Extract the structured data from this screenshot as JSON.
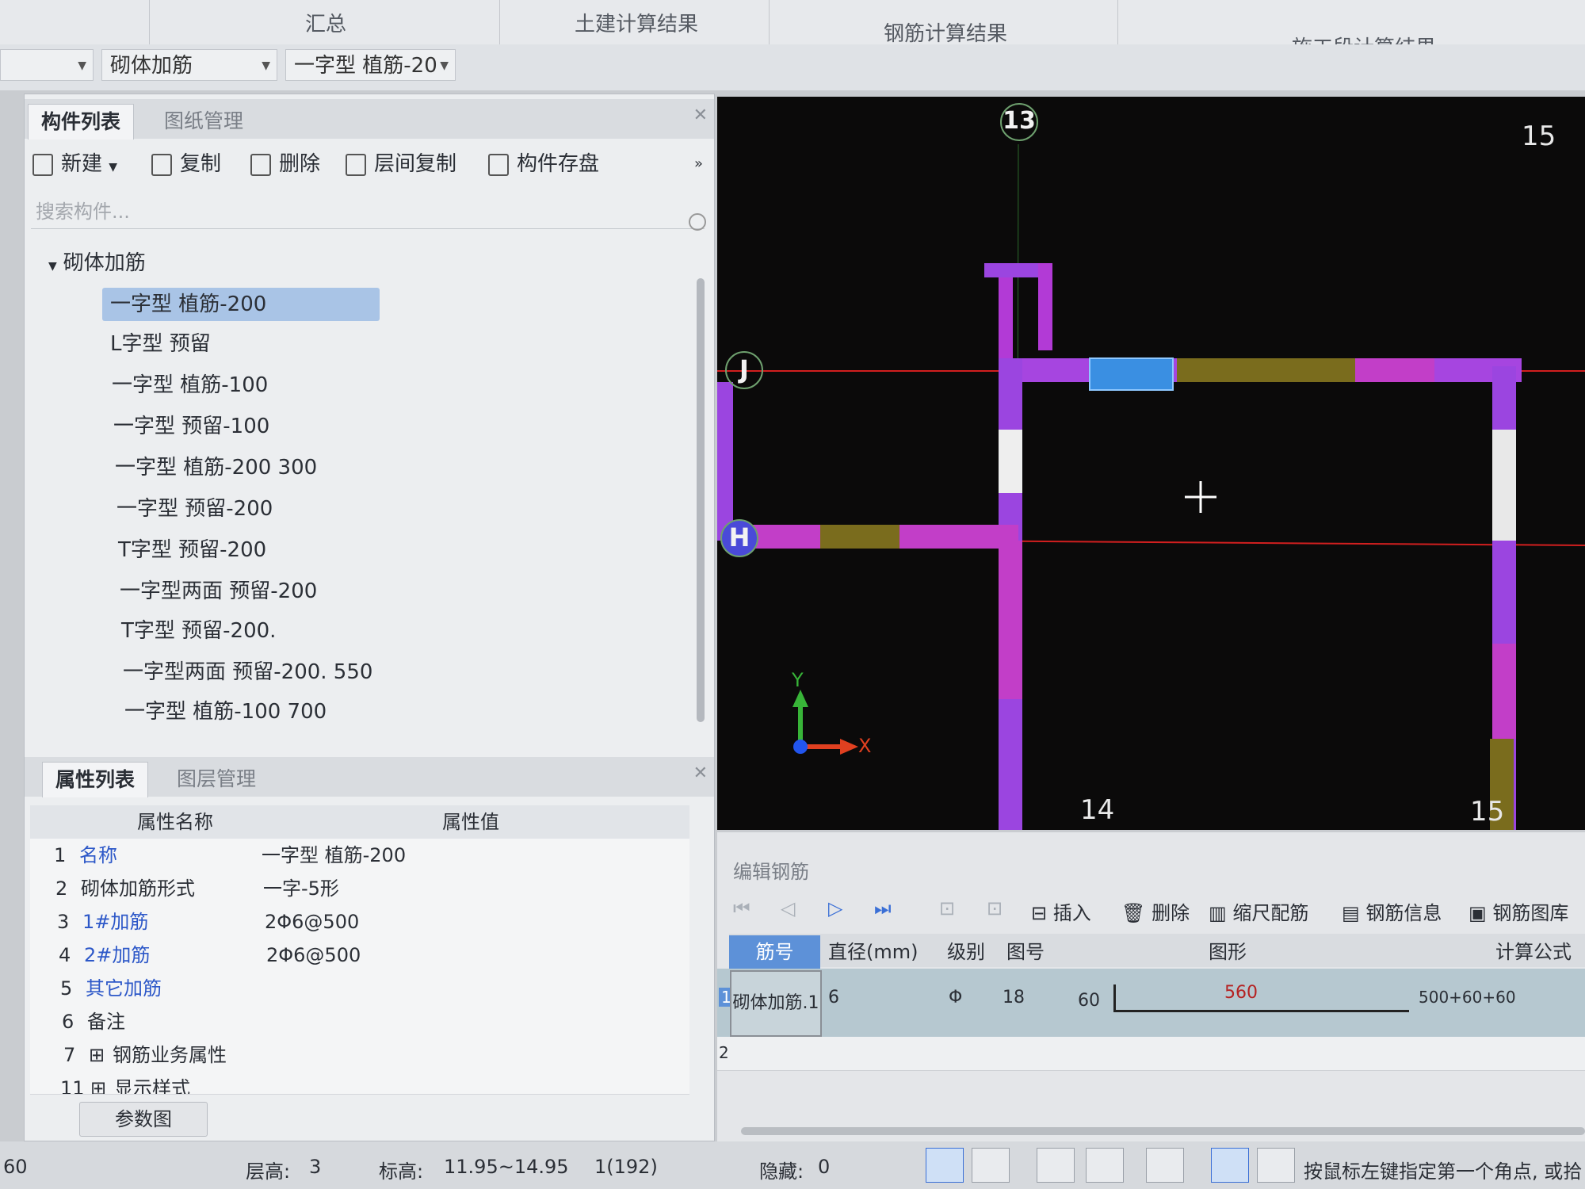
{
  "top_tabs": [
    "汇总",
    "土建计算结果",
    "钢筋计算结果",
    "施工段计算结果"
  ],
  "selectors": {
    "type": "砌体加筋",
    "component": "一字型 植筋-20"
  },
  "component_panel": {
    "tabs": [
      "构件列表",
      "图纸管理"
    ],
    "toolbar": {
      "new": "新建",
      "copy": "复制",
      "delete": "删除",
      "floor_copy": "层间复制",
      "save": "构件存盘"
    },
    "search_placeholder": "搜索构件...",
    "group": "砌体加筋",
    "items": [
      "一字型 植筋-200",
      "L字型 预留",
      "一字型 植筋-100",
      "一字型 预留-100",
      "一字型 植筋-200 300",
      "一字型 预留-200",
      "T字型 预留-200",
      "一字型两面 预留-200",
      "T字型 预留-200.",
      "一字型两面 预留-200. 550",
      "一字型 植筋-100 700"
    ]
  },
  "property_panel": {
    "tabs": [
      "属性列表",
      "图层管理"
    ],
    "headers": {
      "name": "属性名称",
      "value": "属性值"
    },
    "rows": [
      {
        "num": "1",
        "name": "名称",
        "value": "一字型 植筋-200"
      },
      {
        "num": "2",
        "name": "砌体加筋形式",
        "value": "一字-5形"
      },
      {
        "num": "3",
        "name": "1#加筋",
        "value": "2Φ6@500"
      },
      {
        "num": "4",
        "name": "2#加筋",
        "value": "2Φ6@500"
      },
      {
        "num": "5",
        "name": "其它加筋",
        "value": ""
      },
      {
        "num": "6",
        "name": "备注",
        "value": ""
      },
      {
        "num": "7",
        "name": "钢筋业务属性",
        "value": ""
      },
      {
        "num": "11",
        "name": "显示样式",
        "value": ""
      }
    ],
    "param_button": "参数图"
  },
  "canvas": {
    "axis_labels": {
      "top_13": "13",
      "top_15": "15",
      "bottom_14": "14",
      "bottom_15": "15",
      "row_j": "J",
      "row_h": "H"
    },
    "coord_x": "X",
    "coord_y": "Y"
  },
  "rebar_editor": {
    "title": "编辑钢筋",
    "toolbar": {
      "insert": "插入",
      "delete": "删除",
      "scale": "缩尺配筋",
      "info": "钢筋信息",
      "library": "钢筋图库"
    },
    "headers": {
      "bar_no": "筋号",
      "diameter": "直径(mm)",
      "grade": "级别",
      "shape_no": "图号",
      "shape": "图形",
      "formula": "计算公式"
    },
    "rows": [
      {
        "num": "1",
        "bar_no": "砌体加筋.1",
        "diameter": "6",
        "grade": "Φ",
        "shape_no": "18",
        "hook": "60",
        "length": "560",
        "formula": "500+60+60"
      },
      {
        "num": "2"
      }
    ]
  },
  "status_bar": {
    "left_value": "60",
    "floor_height_label": "层高:",
    "floor_height": "3",
    "elevation_label": "标高:",
    "elevation": "11.95~14.95",
    "count": "1(192)",
    "hidden_label": "隐藏:",
    "hidden": "0",
    "hint": "按鼠标左键指定第一个角点, 或拾"
  }
}
